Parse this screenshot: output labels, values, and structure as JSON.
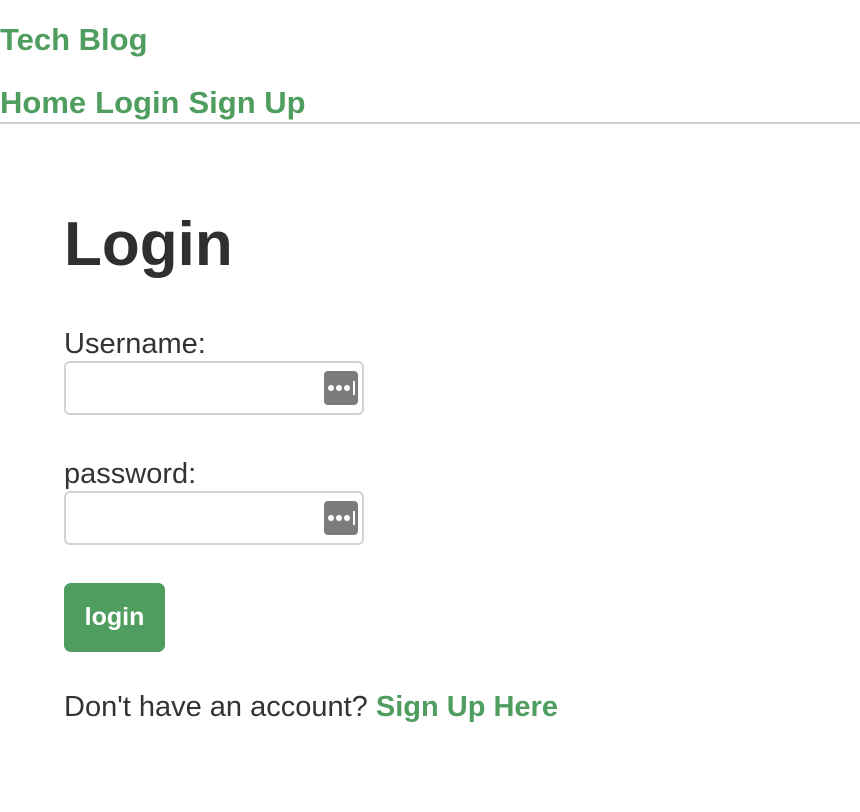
{
  "header": {
    "site_title": "Tech Blog",
    "nav": {
      "home": "Home",
      "login": "Login",
      "signup": "Sign Up"
    }
  },
  "form": {
    "title": "Login",
    "username_label": "Username:",
    "username_value": "",
    "password_label": "password:",
    "password_value": "",
    "submit_label": "login",
    "signup_prompt": "Don't have an account?",
    "signup_link": "Sign Up Here"
  },
  "colors": {
    "accent": "#4f9d5f",
    "text": "#333333",
    "divider": "#cfcfcf",
    "input_border": "#d3d3d3",
    "password_manager_icon": "#7c7c7c"
  },
  "icons": {
    "password_manager": "password-manager-key-icon"
  }
}
